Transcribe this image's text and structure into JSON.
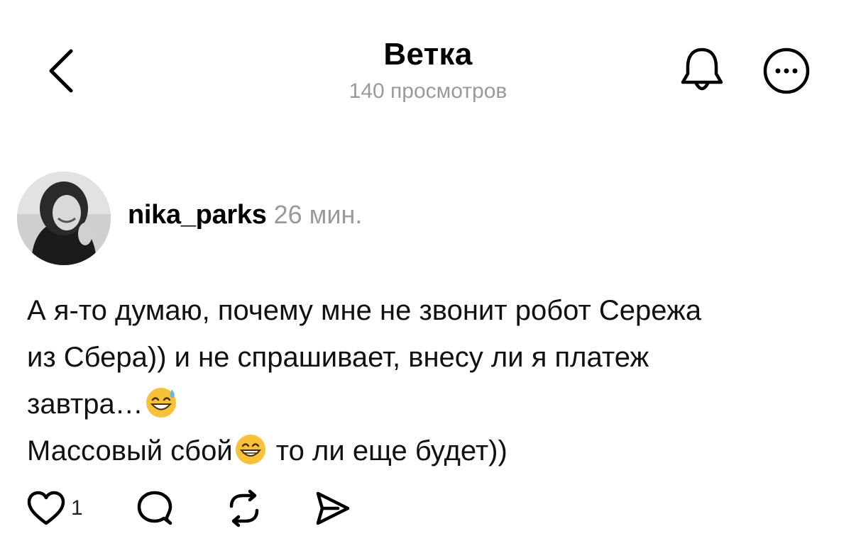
{
  "header": {
    "title": "Ветка",
    "subtitle": "140 просмотров"
  },
  "post": {
    "username": "nika_parks",
    "time": "26 мин.",
    "lines": [
      "А я-то думаю, почему мне не звонит робот Сережа",
      "из Сбера)) и не спрашивает, внесу ли я платеж",
      "завтра…",
      "Массовый сбой",
      " то ли еще будет))"
    ],
    "emojis": [
      "sweat-smile-emoji",
      "grin-emoji"
    ],
    "likes": "1"
  },
  "icons": {
    "back": "chevron-left-icon",
    "bell": "bell-icon",
    "more": "more-circle-icon",
    "like": "heart-icon",
    "comment": "comment-icon",
    "repost": "repost-icon",
    "share": "send-icon"
  },
  "colors": {
    "text": "#000000",
    "muted": "#9a9a9a",
    "emoji": "#f7c23a"
  }
}
